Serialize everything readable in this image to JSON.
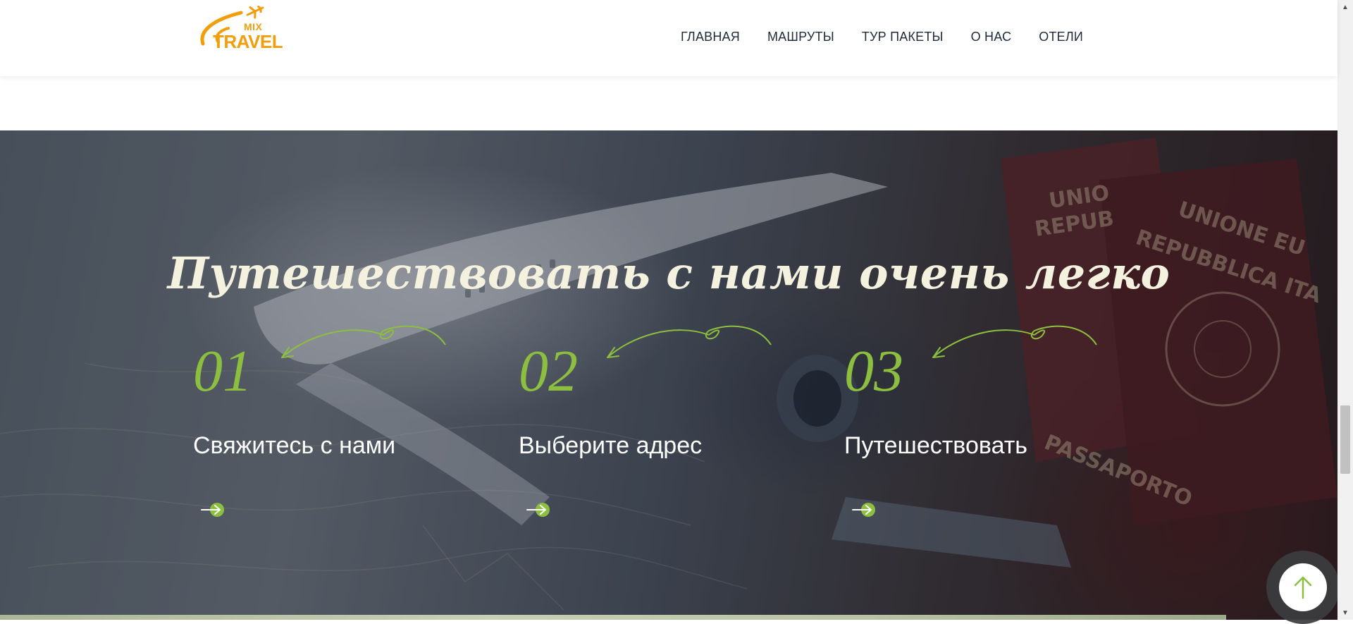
{
  "header": {
    "logo": {
      "mix": "MIX",
      "travel": "TRAVEL"
    },
    "nav": [
      {
        "label": "ГЛАВНАЯ"
      },
      {
        "label": "МАШРУТЫ"
      },
      {
        "label": "ТУР ПАКЕТЫ"
      },
      {
        "label": "О НАС"
      },
      {
        "label": "ОТЕЛИ"
      }
    ]
  },
  "hero": {
    "title": "Путешествовать с нами очень легко",
    "steps": [
      {
        "number": "01",
        "label": "Свяжитесь с нами",
        "icon": "arrow-right-icon"
      },
      {
        "number": "02",
        "label": "Выберите адрес",
        "icon": "arrow-right-icon"
      },
      {
        "number": "03",
        "label": "Путешествовать",
        "icon": "arrow-right-icon"
      }
    ]
  },
  "scroll_top": {
    "icon": "arrow-up-icon"
  },
  "colors": {
    "accent": "#8cbf3f",
    "logo": "#f29d0a",
    "nav_text": "#1f2a3b",
    "hero_title": "#f4f1df"
  }
}
